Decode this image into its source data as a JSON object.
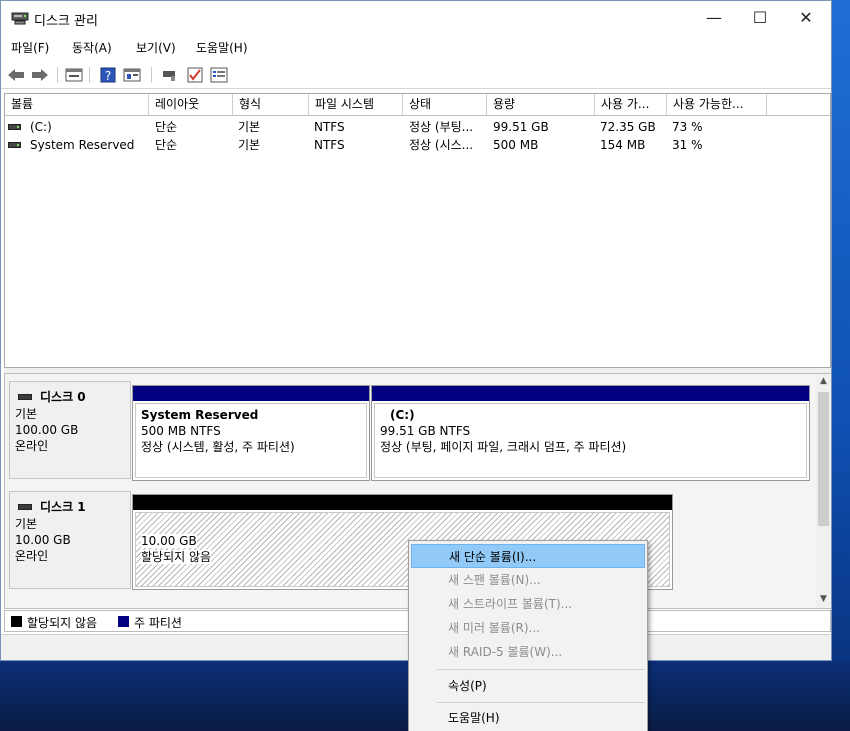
{
  "window": {
    "title": "디스크 관리",
    "controls": {
      "minimize": "—",
      "maximize": "☐",
      "close": "✕"
    }
  },
  "menu": [
    {
      "label": "파일(F)"
    },
    {
      "label": "동작(A)"
    },
    {
      "label": "보기(V)"
    },
    {
      "label": "도움말(H)"
    }
  ],
  "toolbar_icons": [
    "back-arrow-icon",
    "forward-arrow-icon",
    "disk-list-icon",
    "help-icon",
    "properties-icon",
    "refresh-icon",
    "check-icon",
    "list-view-icon"
  ],
  "volume_table": {
    "columns": [
      "볼륨",
      "레이아웃",
      "형식",
      "파일 시스템",
      "상태",
      "용량",
      "사용 가...",
      "사용 가능한..."
    ],
    "rows": [
      {
        "volume": "(C:)",
        "layout": "단순",
        "type": "기본",
        "fs": "NTFS",
        "status": "정상 (부팅...",
        "capacity": "99.51 GB",
        "free": "72.35 GB",
        "free_pct": "73 %"
      },
      {
        "volume": "System Reserved",
        "layout": "단순",
        "type": "기본",
        "fs": "NTFS",
        "status": "정상 (시스...",
        "capacity": "500 MB",
        "free": "154 MB",
        "free_pct": "31 %"
      }
    ]
  },
  "disks": [
    {
      "name": "디스크 0",
      "kind": "기본",
      "size": "100.00 GB",
      "state": "온라인",
      "partitions": [
        {
          "title": "System Reserved",
          "line1": "500 MB NTFS",
          "line2": "정상 (시스템, 활성, 주 파티션)"
        },
        {
          "title": "(C:)",
          "line1": "99.51 GB NTFS",
          "line2": "정상 (부팅, 페이지 파일, 크래시 덤프, 주 파티션)"
        }
      ]
    },
    {
      "name": "디스크 1",
      "kind": "기본",
      "size": "10.00 GB",
      "state": "온라인",
      "unallocated": {
        "size": "10.00 GB",
        "label": "할당되지 않음"
      }
    }
  ],
  "legend": [
    {
      "label": "할당되지 않음",
      "color": "#000000"
    },
    {
      "label": "주 파티션",
      "color": "#000080"
    }
  ],
  "context_menu": {
    "items": [
      {
        "label": "새 단순 볼륨(I)...",
        "enabled": true,
        "highlighted": true
      },
      {
        "label": "새 스팬 볼륨(N)...",
        "enabled": false
      },
      {
        "label": "새 스트라이프 볼륨(T)...",
        "enabled": false
      },
      {
        "label": "새 미러 볼륨(R)...",
        "enabled": false
      },
      {
        "label": "새 RAID-5 볼륨(W)...",
        "enabled": false
      },
      {
        "label": "속성(P)",
        "enabled": true
      },
      {
        "label": "도움말(H)",
        "enabled": true
      }
    ]
  },
  "colors": {
    "primary_partition_bar": "#000080",
    "unallocated_bar": "#000000",
    "menu_highlight": "#91c9f7"
  }
}
